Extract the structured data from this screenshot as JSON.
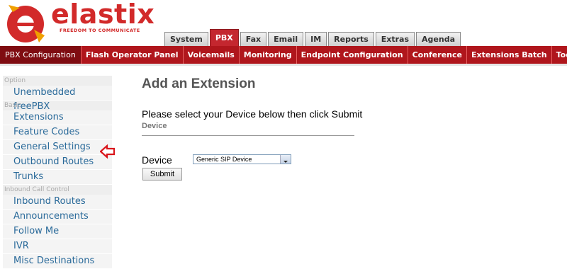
{
  "brand": {
    "name": "elastix",
    "tagline": "FREEDOM TO COMMUNICATE",
    "color": "#d22a2a"
  },
  "tabs": [
    {
      "label": "System",
      "active": false
    },
    {
      "label": "PBX",
      "active": true
    },
    {
      "label": "Fax",
      "active": false
    },
    {
      "label": "Email",
      "active": false
    },
    {
      "label": "IM",
      "active": false
    },
    {
      "label": "Reports",
      "active": false
    },
    {
      "label": "Extras",
      "active": false
    },
    {
      "label": "Agenda",
      "active": false
    }
  ],
  "modules": [
    {
      "label": "PBX Configuration",
      "active": true
    },
    {
      "label": "Flash Operator Panel",
      "active": false
    },
    {
      "label": "Voicemails",
      "active": false
    },
    {
      "label": "Monitoring",
      "active": false
    },
    {
      "label": "Endpoint Configuration",
      "active": false
    },
    {
      "label": "Conference",
      "active": false
    },
    {
      "label": "Extensions Batch",
      "active": false
    },
    {
      "label": "Tools",
      "active": false
    }
  ],
  "sidebar": {
    "sections": [
      {
        "title": "Option",
        "items": [
          "Unembedded freePBX"
        ]
      },
      {
        "title": "Basic",
        "items": [
          "Extensions",
          "Feature Codes",
          "General Settings",
          "Outbound Routes",
          "Trunks"
        ]
      },
      {
        "title": "Inbound Call Control",
        "items": [
          "Inbound Routes",
          "Announcements",
          "Follow Me",
          "IVR",
          "Misc Destinations"
        ]
      }
    ],
    "highlighted_item": "General Settings",
    "arrow_icon": "left-arrow-icon",
    "arrow_color": "#d9161c"
  },
  "content": {
    "title": "Add an Extension",
    "instruction": "Please select your Device below then click Submit",
    "section_label": "Device",
    "field_label": "Device",
    "device_value": "Generic SIP Device",
    "submit_label": "Submit"
  },
  "colors": {
    "module_bar": "#b0161c",
    "active_tab": "#c4272f",
    "link": "#2a6a9a"
  }
}
